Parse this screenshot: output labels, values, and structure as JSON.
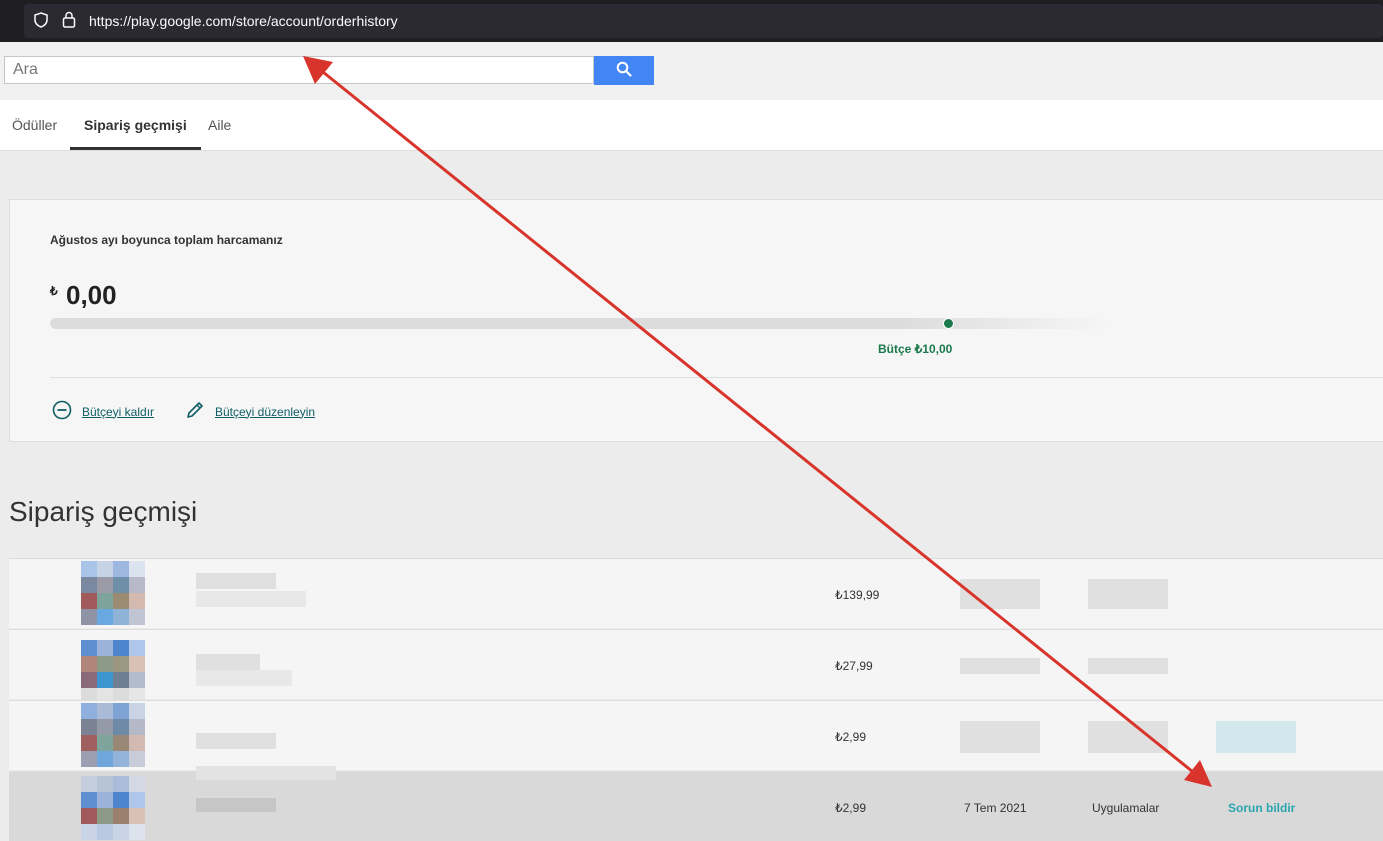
{
  "browser": {
    "url": "https://play.google.com/store/account/orderhistory",
    "icons": [
      "shield-icon",
      "lock-icon"
    ]
  },
  "search": {
    "placeholder": "Ara",
    "icon": "search-icon",
    "button_color": "#4285f4"
  },
  "tabs": [
    {
      "label": "Ödüller",
      "active": false
    },
    {
      "label": "Sipariş geçmişi",
      "active": true
    },
    {
      "label": "Aile",
      "active": false
    }
  ],
  "budget": {
    "label": "Ağustos ayı boyunca toplam harcamanız",
    "currency_symbol": "₺",
    "amount": "0,00",
    "budget_label": "Bütçe ₺10,00",
    "accent_color": "#1a7a4c",
    "actions": [
      {
        "label": "Bütçeyi kaldır",
        "icon": "minus-circle-icon"
      },
      {
        "label": "Bütçeyi düzenleyin",
        "icon": "pencil-icon"
      }
    ]
  },
  "order_history": {
    "title": "Sipariş geçmişi",
    "orders": [
      {
        "price": "₺139,99",
        "date": "",
        "category": "",
        "report": ""
      },
      {
        "price": "₺27,99",
        "date": "",
        "category": "",
        "report": ""
      },
      {
        "price": "₺2,99",
        "date": "",
        "category": "",
        "report": ""
      },
      {
        "price": "₺2,99",
        "date": "7 Tem 2021",
        "category": "Uygulamalar",
        "report": "Sorun bildir"
      }
    ]
  },
  "annotation": {
    "arrow_color": "#d9342b"
  }
}
